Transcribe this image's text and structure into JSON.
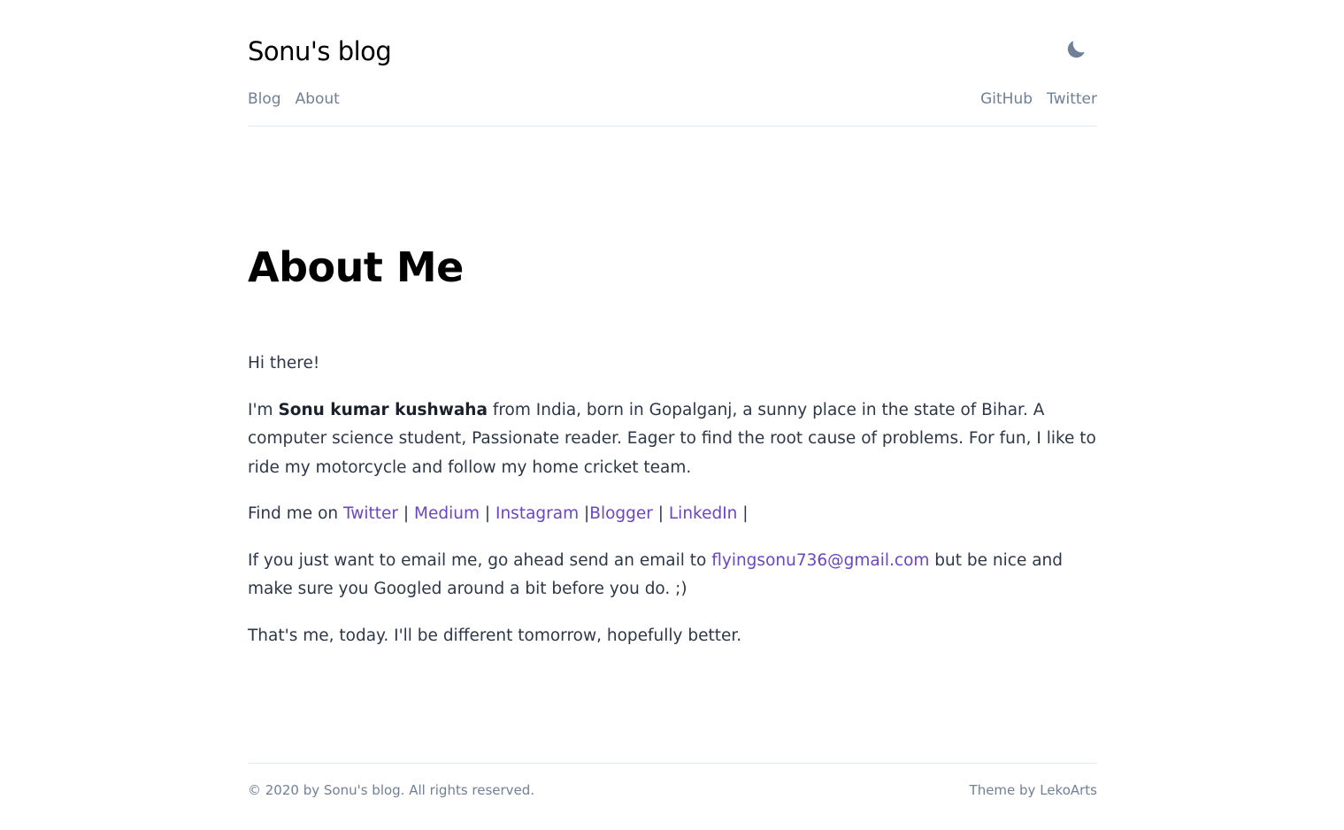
{
  "header": {
    "site_title": "Sonu's blog",
    "theme_toggle_icon": "moon-icon"
  },
  "nav": {
    "left": [
      {
        "label": "Blog"
      },
      {
        "label": "About"
      }
    ],
    "right": [
      {
        "label": "GitHub"
      },
      {
        "label": "Twitter"
      }
    ]
  },
  "page": {
    "heading": "About Me",
    "greeting": "Hi there!",
    "intro_prefix": "I'm ",
    "intro_name": "Sonu kumar kushwaha",
    "intro_rest": " from India, born in Gopalganj, a sunny place in the state of Bihar. A computer science student, Passionate reader. Eager to find the root cause of problems. For fun, I like to ride my motorcycle and follow my home cricket team.",
    "find_me_prefix": "Find me on ",
    "links": {
      "twitter": "Twitter",
      "medium": "Medium",
      "instagram": "Instagram",
      "blogger": "Blogger",
      "linkedin": "LinkedIn"
    },
    "sep_1": " | ",
    "sep_2": " | ",
    "sep_3": " |",
    "sep_4": " | ",
    "sep_5": " |",
    "email_prefix": "If you just want to email me, go ahead send an email to ",
    "email": "flyingsonu736@gmail.com",
    "email_suffix": " but be nice and make sure you Googled around a bit before you do. ;)",
    "closing": "That's me, today. I'll be different tomorrow, hopefully better."
  },
  "footer": {
    "copyright": "© 2020 by Sonu's blog. All rights reserved.",
    "theme_prefix": "Theme by ",
    "theme_author": "LekoArts"
  },
  "colors": {
    "link": "#6b46c1",
    "muted": "#718096",
    "text": "#2d3748",
    "divider": "#e2e8f0"
  }
}
